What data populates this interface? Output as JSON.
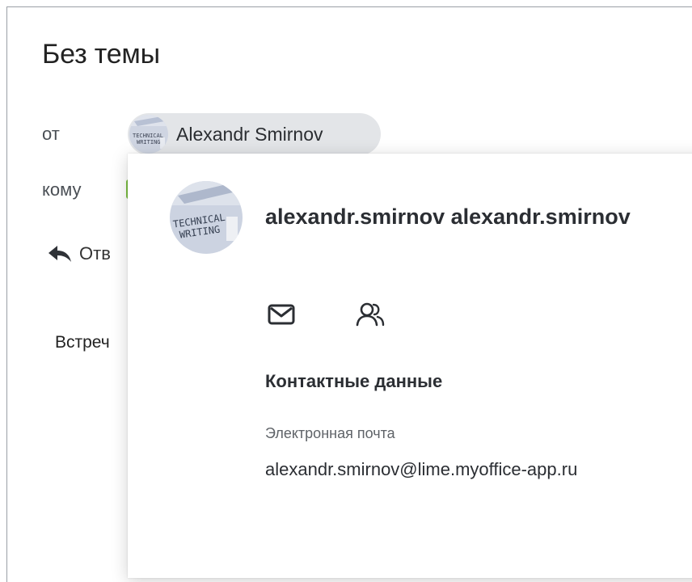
{
  "message": {
    "subject": "Без темы",
    "from_label": "от",
    "to_label": "кому",
    "sender_name": "Alexandr Smirnov",
    "reply_label": "Отв",
    "body_preview": "Встреч"
  },
  "avatar": {
    "text_line1": "TECHNICAL",
    "text_line2": "WRITING"
  },
  "contact_card": {
    "display_name": "alexandr.smirnov alexandr.smirnov",
    "section_title": "Контактные данные",
    "email_label": "Электронная почта",
    "email_value": "alexandr.smirnov@lime.myoffice-app.ru",
    "actions": [
      {
        "icon": "mail-icon"
      },
      {
        "icon": "people-icon"
      }
    ]
  },
  "colors": {
    "chip_background": "#e3e5e8",
    "recipient_accent": "#7bc043",
    "text_primary": "#2b2e33"
  }
}
